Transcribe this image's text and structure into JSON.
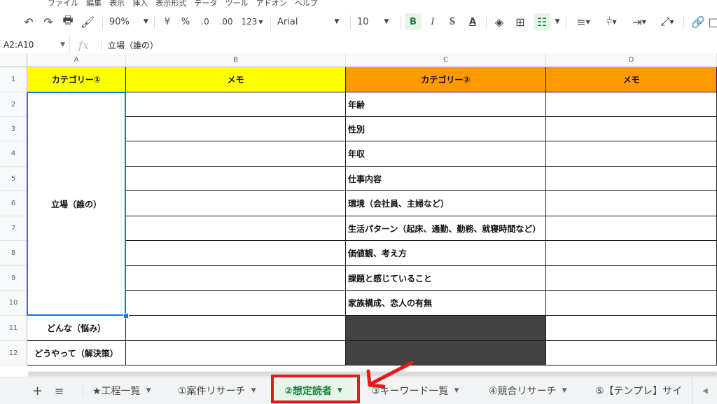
{
  "menubar": [
    "ファイル",
    "編集",
    "表示",
    "挿入",
    "表示形式",
    "データ",
    "ツール",
    "アドオン",
    "ヘルプ"
  ],
  "toolbar": {
    "zoom": "90%",
    "currency": "¥",
    "percent": "%",
    "dec_decrease": ".0",
    "dec_increase": ".00",
    "number_format": "123",
    "font": "Arial",
    "font_size": "10",
    "bold": "B",
    "italic": "I",
    "strike": "S",
    "textcolor": "A"
  },
  "formula_bar": {
    "namebox": "A2:A10",
    "fx": "fx",
    "value": "立場（誰の）"
  },
  "columns": [
    "A",
    "B",
    "C",
    "D"
  ],
  "rows": [
    "1",
    "2",
    "3",
    "4",
    "5",
    "6",
    "7",
    "8",
    "9",
    "10",
    "11",
    "12"
  ],
  "cells": {
    "header": {
      "a": "カテゴリー①",
      "b": "メモ",
      "c": "カテゴリー②",
      "d": "メモ"
    },
    "a_merged": "立場（誰の）",
    "a11": "どんな（悩み）",
    "a12": "どうやって（解決策）",
    "c_items": [
      "年齢",
      "性別",
      "年収",
      "仕事内容",
      "環境（会社員、主婦など）",
      "生活パターン（起床、通勤、勤務、就寝時間など）",
      "価値観、考え方",
      "課題と感じていること",
      "家族構成、恋人の有無"
    ]
  },
  "tabs": [
    {
      "label": "★工程一覧"
    },
    {
      "label": "①案件リサーチ"
    },
    {
      "label": "②想定読者",
      "active": true
    },
    {
      "label": "③キーワード一覧"
    },
    {
      "label": "④競合リサーチ"
    },
    {
      "label": "⑤【テンプレ】サイ"
    }
  ],
  "colors": {
    "yellow": "#ffff00",
    "orange": "#ff9900",
    "dark": "#434343",
    "selection": "#1a73e8",
    "highlight": "#e81818"
  }
}
